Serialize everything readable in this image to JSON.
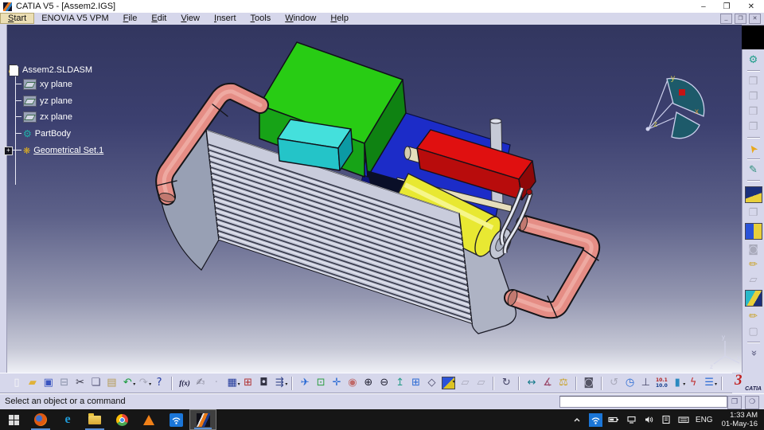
{
  "window": {
    "title": "CATIA V5 - [Assem2.IGS]",
    "min_glyph": "–",
    "restore_glyph": "❐",
    "close_glyph": "✕"
  },
  "child_window": {
    "min_glyph": "_",
    "restore_glyph": "❐",
    "close_glyph": "✕"
  },
  "menu": {
    "items": [
      {
        "label": "Start",
        "u": true,
        "active": true
      },
      {
        "label": "ENOVIA V5 VPM",
        "u": false
      },
      {
        "label": "File",
        "u": true
      },
      {
        "label": "Edit",
        "u": true
      },
      {
        "label": "View",
        "u": true
      },
      {
        "label": "Insert",
        "u": true
      },
      {
        "label": "Tools",
        "u": true
      },
      {
        "label": "Window",
        "u": true
      },
      {
        "label": "Help",
        "u": true
      }
    ]
  },
  "tree": {
    "root": "Assem2.SLDASM",
    "items": [
      "xy plane",
      "yz plane",
      "zx plane",
      "PartBody",
      "Geometrical Set.1"
    ],
    "expander_glyph": "+"
  },
  "viewport": {
    "compass": {
      "x": "x",
      "y": "y",
      "z": "z"
    },
    "triad": {
      "x": "x",
      "y": "y",
      "z": "z"
    },
    "model_parts": [
      "intercooler-core",
      "left-pipe",
      "right-pipe",
      "green-box",
      "cyan-box",
      "red-box",
      "yellow-cylinder",
      "blue-plate",
      "pulley-disc",
      "handle-rod",
      "drive-shaft"
    ]
  },
  "colors": {
    "core": "#c9ccdc",
    "core_cap": "#98a0b4",
    "core_cap_right": "#aeb3c4",
    "pipe": "#e58d85",
    "pipe_dark": "#c27970",
    "green_top": "#28cc14",
    "green_front": "#17a317",
    "green_right": "#0f8212",
    "red_top": "#e01010",
    "red_front": "#b80c0c",
    "red_right": "#8e0808",
    "yellow": "#e8e832",
    "cyan_top": "#44e0dc",
    "cyan_front": "#24c4c8",
    "cyan_right": "#0c9aa4",
    "plate": "#1c2cc8",
    "plate_dark": "#0e1478",
    "shaft": "#e6debc",
    "disc": "#c2c6d4",
    "bg_top": "#32365f",
    "bg_bottom": "#eff0f6",
    "compass_fill": "#1d5a6a",
    "compass_line": "#ccd0ec",
    "label_yellow": "#d3cb4e",
    "label_orange": "#cf8a3c"
  },
  "toolbars": {
    "right": [
      {
        "n": "product-gear-icon",
        "g": "⚙",
        "c": "#1f9d8a"
      },
      {
        "sep": true
      },
      {
        "n": "new-component-icon",
        "g": "❒",
        "c": "#a9aabb"
      },
      {
        "n": "new-product-icon",
        "g": "❐",
        "c": "#a9aabb"
      },
      {
        "n": "new-part-icon",
        "g": "❒",
        "c": "#a9aabb"
      },
      {
        "n": "existing-component-icon",
        "g": "❐",
        "c": "#a9aabb"
      },
      {
        "sep": true
      },
      {
        "n": "select-arrow-icon",
        "g": "➤",
        "c": "#e8a81c",
        "cls": "rot-ul"
      },
      {
        "sep": true
      },
      {
        "n": "sketcher-icon",
        "g": "✎",
        "c": "#2a8d7a"
      },
      {
        "sep": true
      },
      {
        "n": "part-design-icon",
        "g": "",
        "cls": "sq sq-part"
      },
      {
        "n": "window-frame-icon",
        "g": "❐",
        "c": "#a9aabb"
      },
      {
        "n": "split-view-icon",
        "g": "",
        "cls": "sq sq-split"
      },
      {
        "n": "camera-gray-icon",
        "g": "◙",
        "c": "#a9aabb"
      },
      {
        "n": "pencil-gold-icon",
        "g": "✏",
        "c": "#c9a227"
      },
      {
        "n": "surface-gray-icon",
        "g": "▱",
        "c": "#a9aabb"
      },
      {
        "n": "iso-cube-icon",
        "g": "",
        "cls": "sq sq-cube"
      },
      {
        "n": "pencil-gold2-icon",
        "g": "✏",
        "c": "#c9a227"
      },
      {
        "n": "surface-gray2-icon",
        "g": "▢",
        "c": "#a9aabb"
      },
      {
        "sep": true
      },
      {
        "n": "more-tools-chevron-icon",
        "g": "»",
        "c": "#55557a",
        "cls": "rot-90"
      }
    ],
    "bottom": [
      {
        "n": "new-file-icon",
        "g": "▯",
        "c": "#f8f8f8"
      },
      {
        "n": "open-folder-icon",
        "g": "▰",
        "c": "#e0b23a"
      },
      {
        "n": "save-icon",
        "g": "▣",
        "c": "#3a55c0"
      },
      {
        "n": "print-icon",
        "g": "⊟",
        "c": "#8890a8"
      },
      {
        "n": "cut-icon",
        "g": "✂",
        "c": "#333344"
      },
      {
        "n": "copy-icon",
        "g": "❏",
        "c": "#555577"
      },
      {
        "n": "paste-icon",
        "g": "▤",
        "c": "#b59a55"
      },
      {
        "n": "undo-icon",
        "g": "↶",
        "c": "#159a3a",
        "dd": true
      },
      {
        "n": "redo-icon",
        "g": "↷",
        "c": "#a9aabb",
        "dd": true
      },
      {
        "n": "whats-this-icon",
        "g": "?",
        "c": "#2238a0"
      },
      {
        "sep": true
      },
      {
        "n": "formula-icon",
        "g": "f(x)",
        "c": "#15153a",
        "cls": "fx"
      },
      {
        "n": "annotation-icon",
        "g": "✍",
        "c": "#777788"
      },
      {
        "n": "knowledge-dot-icon",
        "g": "·",
        "c": "#a9aabb"
      },
      {
        "n": "design-table-icon",
        "g": "▦",
        "c": "#223a9a",
        "dd": true
      },
      {
        "n": "product-graph-icon",
        "g": "⊞",
        "c": "#b03030"
      },
      {
        "n": "lock-icon",
        "g": "◘",
        "c": "#333344"
      },
      {
        "n": "constraints-icon",
        "g": "⇶",
        "c": "#334488",
        "dd": true
      },
      {
        "sep": true
      },
      {
        "n": "fly-mode-icon",
        "g": "✈",
        "c": "#2a6ad4"
      },
      {
        "n": "fit-all-icon",
        "g": "⊡",
        "c": "#2a9d3f"
      },
      {
        "n": "pan-icon",
        "g": "✛",
        "c": "#2a6ad4"
      },
      {
        "n": "rotate-view-icon",
        "g": "◉",
        "c": "#c06a6a"
      },
      {
        "n": "zoom-in-icon",
        "g": "⊕",
        "c": "#222233"
      },
      {
        "n": "zoom-out-icon",
        "g": "⊖",
        "c": "#222233"
      },
      {
        "n": "normal-view-icon",
        "g": "↥",
        "c": "#2a9d8a"
      },
      {
        "n": "multi-view-icon",
        "g": "⊞",
        "c": "#2a6ad4"
      },
      {
        "n": "iso-view-icon",
        "g": "◇",
        "c": "#444466"
      },
      {
        "n": "shaded-view-icon",
        "g": "",
        "cls": "sq sq-shaded",
        "dd": true
      },
      {
        "n": "hidden-mode-icon",
        "g": "▱",
        "c": "#a9aabb"
      },
      {
        "n": "hidden-mode2-icon",
        "g": "▱",
        "c": "#a9aabb"
      },
      {
        "sep": true
      },
      {
        "n": "turntable-icon",
        "g": "↻",
        "c": "#444466"
      },
      {
        "sep": true
      },
      {
        "n": "measure-icon",
        "g": "↔",
        "c": "#157a8a"
      },
      {
        "n": "measure-item-icon",
        "g": "∡",
        "c": "#994466"
      },
      {
        "n": "mass-properties-icon",
        "g": "⚖",
        "c": "#c9a227"
      },
      {
        "sep": true
      },
      {
        "n": "capture-camera-icon",
        "g": "◙",
        "c": "#555566"
      },
      {
        "sep": true
      },
      {
        "n": "spiral-icon",
        "g": "↺",
        "c": "#a9aabb"
      },
      {
        "n": "globe-clock-icon",
        "g": "◷",
        "c": "#2a6ad4"
      },
      {
        "n": "axis-system-icon",
        "g": "⊥",
        "c": "#444466"
      },
      {
        "n": "units-icon",
        "g": "10.1",
        "g2": "10.0",
        "c": "#b02020",
        "cls": "units"
      },
      {
        "n": "cylinder-icon",
        "g": "▮",
        "c": "#2a8ac0",
        "dd": true
      },
      {
        "n": "bolt-icon",
        "g": "ϟ",
        "c": "#c03030"
      },
      {
        "n": "list-icon",
        "g": "☰",
        "c": "#2a6ad4",
        "dd": true
      },
      {
        "sep": true
      },
      {
        "n": "more-icons-chevron",
        "g": "»",
        "c": "#55557a"
      }
    ]
  },
  "status": {
    "message": "Select an object or a command"
  },
  "logo": {
    "numeral": "3",
    "text": "CATIA"
  },
  "taskbar": {
    "tray": {
      "lang": "ENG",
      "time": "1:33 AM",
      "date": "01-May-16"
    }
  }
}
